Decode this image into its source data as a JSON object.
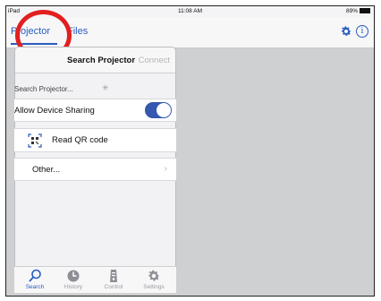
{
  "status_bar": {
    "device": "iPad",
    "time": "11:08 AM",
    "battery": "89%"
  },
  "nav": {
    "tabs": [
      {
        "label": "Projector",
        "active": true
      },
      {
        "label": "Files",
        "active": false
      }
    ],
    "right_icons": [
      "gear-icon",
      "info-icon"
    ]
  },
  "panel": {
    "title": "Search Projector",
    "connect_label": "Connect",
    "search_status": "Search Projector...",
    "device_sharing": {
      "label": "Allow Device Sharing",
      "enabled": true
    },
    "qr_label": "Read QR code",
    "other_label": "Other..."
  },
  "tabbar": {
    "items": [
      {
        "label": "Search",
        "icon": "search-icon",
        "active": true
      },
      {
        "label": "History",
        "icon": "history-icon",
        "active": false
      },
      {
        "label": "Control",
        "icon": "projector-icon",
        "active": false
      },
      {
        "label": "Settings",
        "icon": "gear-icon",
        "active": false
      }
    ]
  },
  "colors": {
    "accent": "#2a5cbf",
    "toggle_on": "#3457b0",
    "highlight": "#e21f1f"
  }
}
